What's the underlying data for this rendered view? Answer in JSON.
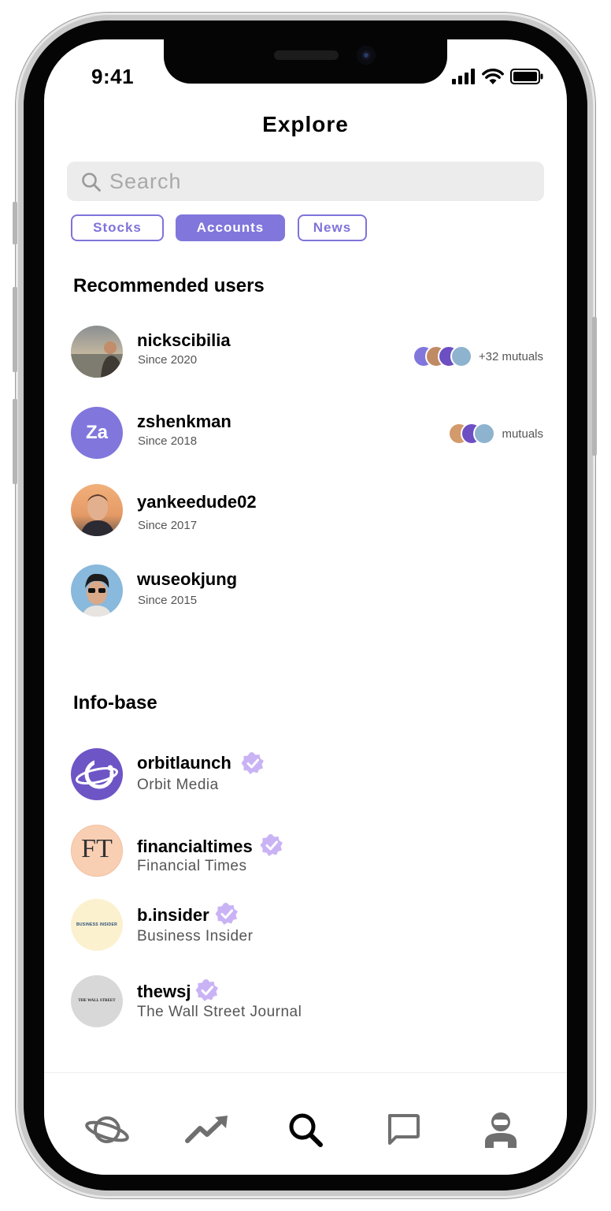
{
  "status_bar": {
    "time": "9:41"
  },
  "header": {
    "title": "Explore"
  },
  "search": {
    "placeholder": "Search"
  },
  "tabs": [
    {
      "label": "Stocks",
      "active": false
    },
    {
      "label": "Accounts",
      "active": true
    },
    {
      "label": "News",
      "active": false
    }
  ],
  "recommended": {
    "title": "Recommended users",
    "users": [
      {
        "username": "nickscibilia",
        "since": "Since 2020",
        "mutuals": "+32 mutuals"
      },
      {
        "username": "zshenkman",
        "since": "Since 2018",
        "avatar_initials": "Za",
        "mutuals": "mutuals"
      },
      {
        "username": "yankeedude02",
        "since": "Since 2017"
      },
      {
        "username": "wuseokjung",
        "since": "Since 2015"
      }
    ]
  },
  "infobase": {
    "title": "Info-base",
    "accounts": [
      {
        "username": "orbitlaunch",
        "name": "Orbit Media",
        "verified": true
      },
      {
        "username": "financialtimes",
        "name": "Financial Times",
        "verified": true,
        "logo_text": "FT"
      },
      {
        "username": "b.insider",
        "name": "Business Insider",
        "verified": true,
        "logo_text": "BUSINESS INSIDER"
      },
      {
        "username": "thewsj",
        "name": "The Wall Street Journal",
        "verified": true,
        "logo_text": "THE WALL STREET JOURNAL"
      }
    ]
  },
  "tabbar": {
    "items": [
      {
        "icon": "planet-icon"
      },
      {
        "icon": "trending-icon"
      },
      {
        "icon": "search-icon",
        "active": true
      },
      {
        "icon": "chat-icon"
      },
      {
        "icon": "profile-icon"
      }
    ]
  },
  "colors": {
    "accent": "#8176dc",
    "verified": "#c9b3f5",
    "text": "#000000",
    "secondary": "#555555"
  }
}
